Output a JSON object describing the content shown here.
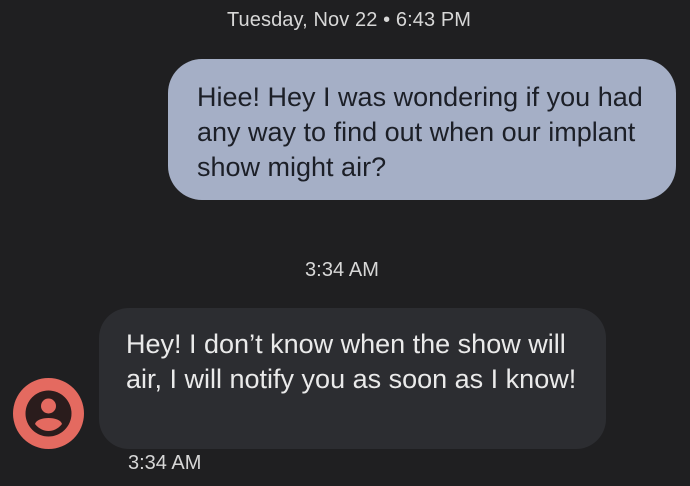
{
  "conversation": {
    "date_header": "Tuesday, Nov 22 • 6:43 PM",
    "messages": [
      {
        "direction": "outgoing",
        "text": "Hiee! Hey I was wondering if you had any way to find out when our implant show might air?"
      },
      {
        "direction": "incoming",
        "timestamp_above": "3:34 AM",
        "text": "Hey! I don’t know when the show will air, I will notify you as soon as I know!",
        "timestamp_below": "3:34 AM",
        "avatar_icon": "person-icon",
        "avatar_color": "#e46a60"
      }
    ]
  },
  "colors": {
    "background": "#1f1f21",
    "outgoing_bubble": "#a5afc6",
    "incoming_bubble": "#2c2d31"
  }
}
